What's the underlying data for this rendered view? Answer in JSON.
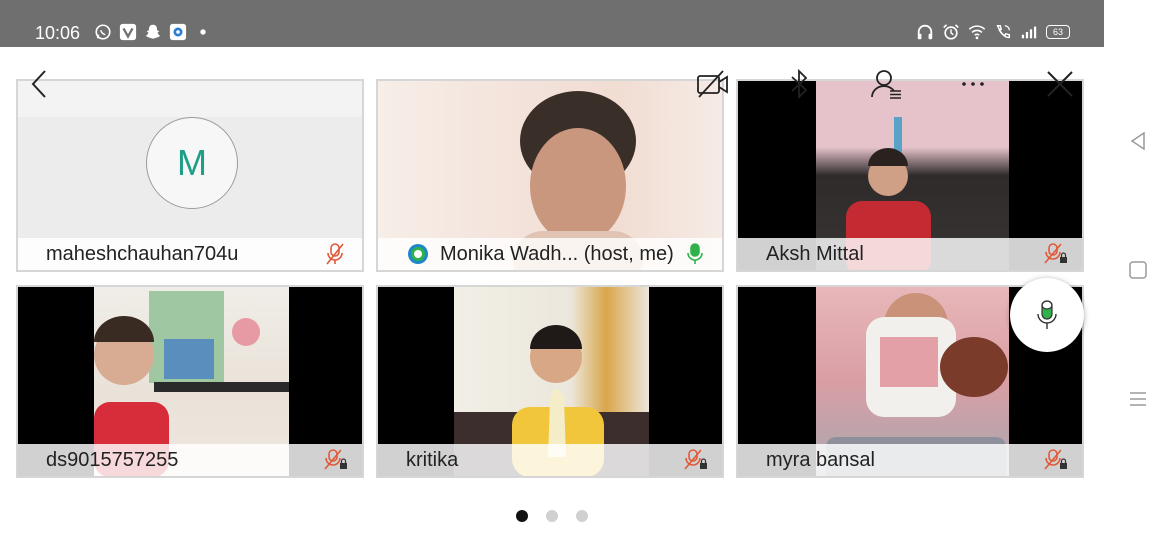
{
  "status_bar": {
    "time": "10:06",
    "left_icons": [
      "whatsapp-icon",
      "v-app-icon",
      "snapchat-icon",
      "app-icon"
    ],
    "right_icons": [
      "headphones-icon",
      "alarm-icon",
      "wifi-icon",
      "wifi-call-icon",
      "signal-icon"
    ],
    "battery": "63"
  },
  "toolbar": {
    "back": "back-icon",
    "video_off": "video-off-icon",
    "bluetooth": "bluetooth-icon",
    "participants": "participants-icon",
    "more": "more-icon",
    "close": "close-icon"
  },
  "participants": [
    {
      "name": "maheshchauhan704u",
      "avatar_letter": "M",
      "mic": "muted"
    },
    {
      "name": "Monika Wadh... (host, me)",
      "mic": "active"
    },
    {
      "name": "Aksh Mittal",
      "mic": "muted-locked"
    },
    {
      "name": "ds9015757255",
      "mic": "muted-locked"
    },
    {
      "name": "kritika",
      "mic": "muted-locked"
    },
    {
      "name": "myra bansal",
      "mic": "muted-locked"
    }
  ],
  "pagination": {
    "total": 3,
    "current": 1
  },
  "colors": {
    "muted": "#e05a3a",
    "active_mic": "#2fb24c",
    "avatar_letter": "#1e9e86"
  }
}
